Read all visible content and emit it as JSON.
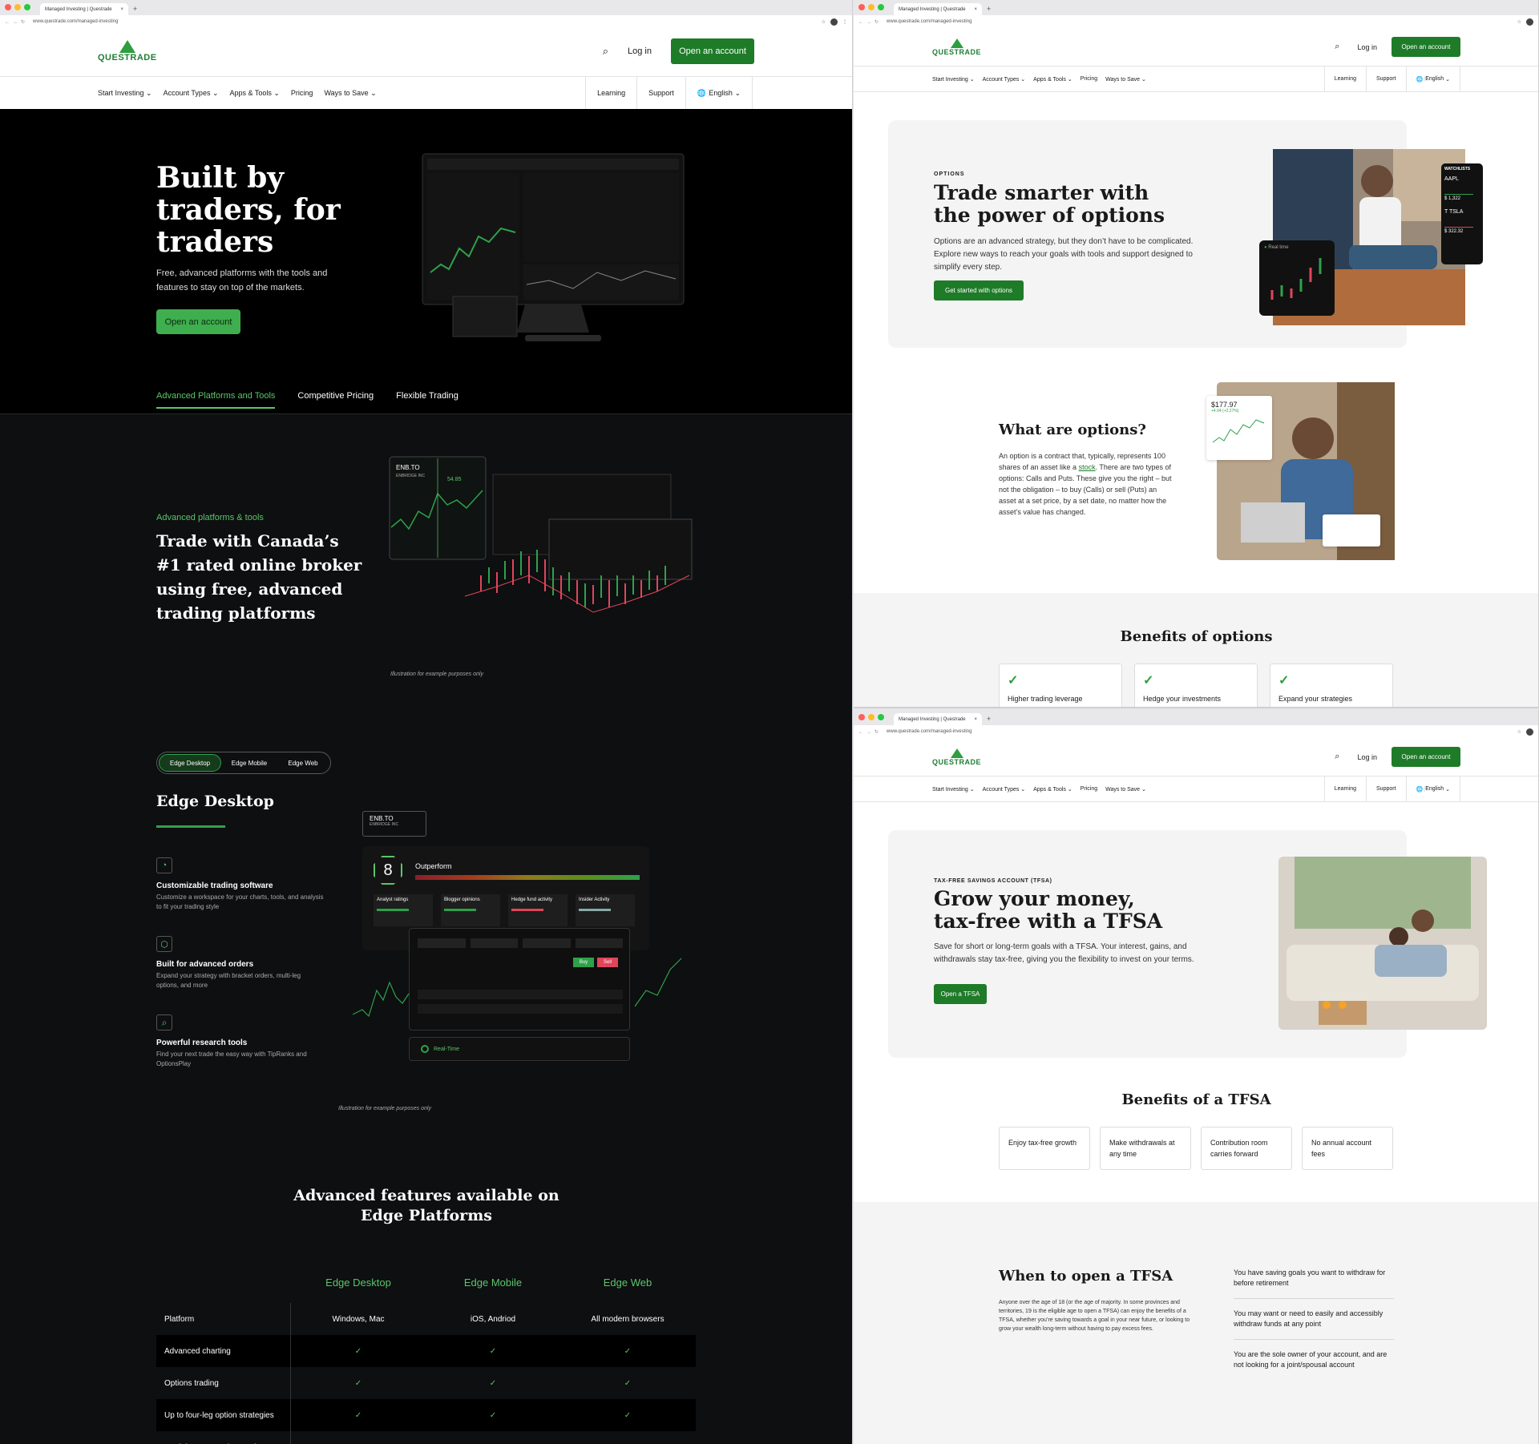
{
  "browser": {
    "tab_title": "Managed Investing | Questrade",
    "url": "www.questrade.com/managed-investing",
    "new_tab": "+",
    "close": "×"
  },
  "header": {
    "logo_text": "QUESTRADE",
    "search_icon": "search-icon",
    "login": "Log in",
    "open_account": "Open an account"
  },
  "nav": {
    "items": [
      "Start Investing",
      "Account Types",
      "Apps & Tools",
      "Pricing",
      "Ways to Save"
    ],
    "chevron": "⌄",
    "right": [
      "Learning",
      "Support",
      "English"
    ]
  },
  "hero": {
    "title": "Built by traders, for traders",
    "subtitle": "Free, advanced platforms with the tools and features to stay on top of the markets.",
    "cta": "Open an account",
    "tabs": [
      "Advanced Platforms and Tools",
      "Competitive Pricing",
      "Flexible Trading"
    ]
  },
  "platforms": {
    "eyebrow": "Advanced platforms & tools",
    "title": "Trade with Canada’s #1 rated online broker using free, advanced trading platforms",
    "ticker": "ENB.TO",
    "ticker_name": "ENBRIDGE INC",
    "price": "54.85",
    "caption": "Illustration for example purposes only"
  },
  "edge": {
    "toggles": [
      "Edge Desktop",
      "Edge Mobile",
      "Edge Web"
    ],
    "title": "Edge Desktop",
    "features": [
      {
        "title": "Customizable trading software",
        "desc": "Customize a workspace for your charts, tools, and analysis to fit your trading style"
      },
      {
        "title": "Built for advanced orders",
        "desc": "Expand your strategy with bracket orders, multi-leg options, and more"
      },
      {
        "title": "Powerful research tools",
        "desc": "Find your next trade the easy way with TipRanks and OptionsPlay"
      }
    ],
    "mock": {
      "ticker": "ENB.TO",
      "ticker_name": "ENBRIDGE INC",
      "score": "8",
      "rating": "Outperform",
      "cards": [
        "Analyst ratings",
        "Blogger opinions",
        "Hedge fund activity",
        "Insider Activity"
      ],
      "buy": "Buy",
      "sell": "Sell",
      "realtime": "Real-Time"
    },
    "caption": "Illustration for example purposes only"
  },
  "features_table": {
    "title": "Advanced features available on Edge Platforms",
    "columns": [
      "Edge Desktop",
      "Edge Mobile",
      "Edge Web"
    ],
    "rows": [
      {
        "label": "Platform",
        "values": [
          "Windows, Mac",
          "iOS, Andriod",
          "All modern browsers"
        ]
      },
      {
        "label": "Advanced charting",
        "values": [
          "✓",
          "✓",
          "✓"
        ]
      },
      {
        "label": "Options trading",
        "values": [
          "✓",
          "✓",
          "✓"
        ]
      },
      {
        "label": "Up to four-leg option strategies",
        "values": [
          "✓",
          "✓",
          "✓"
        ]
      },
      {
        "label": "Real-time, streaming market",
        "values": [
          "",
          "",
          ""
        ]
      }
    ]
  },
  "options_page": {
    "eyebrow": "OPTIONS",
    "title": "Trade smarter with the power of options",
    "desc": "Options are an advanced strategy, but they don’t have to be complicated. Explore new ways to reach your goals with tools and support designed to simplify every step.",
    "cta": "Get started with options",
    "watchlist": "WATCHLISTS",
    "wl_items": [
      {
        "sym": "AAPL",
        "price": "$ 1,322"
      },
      {
        "sym": "TSLA",
        "price": "$ 322.32"
      }
    ],
    "realtime": "Real time",
    "what_title": "What are options?",
    "what_text_before": "An option is a contract that, typically, represents 100 shares of an asset like a ",
    "what_link": "stock",
    "what_text_after": ". There are two types of options: Calls and Puts. These give you the right – but not the obligation – to buy (Calls) or sell (Puts) an asset at a set price, by a set date, no matter how the asset’s value has changed.",
    "price_card": "$177.97",
    "price_change": "+4.04 (+2.27%)",
    "benefits_title": "Benefits of options",
    "benefits": [
      "Higher trading leverage",
      "Hedge your investments",
      "Expand your strategies"
    ]
  },
  "tfsa_page": {
    "eyebrow": "TAX-FREE SAVINGS ACCOUNT (TFSA)",
    "title": "Grow your money, tax-free with a TFSA",
    "desc": "Save for short or long-term goals with a TFSA. Your interest, gains, and withdrawals stay tax-free, giving you the flexibility to invest on your terms.",
    "cta": "Open a TFSA",
    "benefits_title": "Benefits of a TFSA",
    "benefits": [
      "Enjoy tax-free growth",
      "Make withdrawals at any time",
      "Contribution room carries forward",
      "No annual account fees"
    ],
    "when_title": "When to open a TFSA",
    "when_text": "Anyone over the age of 18 (or the age of majority. In some provinces and territories, 19 is the eligible age to open a TFSA) can enjoy the benefits of a TFSA, whether you’re saving towards a goal in your near future, or looking to grow your wealth long-term without having to pay excess fees.",
    "reasons": [
      "You have saving goals you want to withdraw for before retirement",
      "You may want or need to easily and accessibly withdraw funds at any point",
      "You are the sole owner of your account, and are not looking for a joint/spousal account"
    ]
  },
  "colors": {
    "brand_green": "#1e7b28",
    "accent_green": "#5cc56b",
    "dark_bg": "#000000"
  }
}
